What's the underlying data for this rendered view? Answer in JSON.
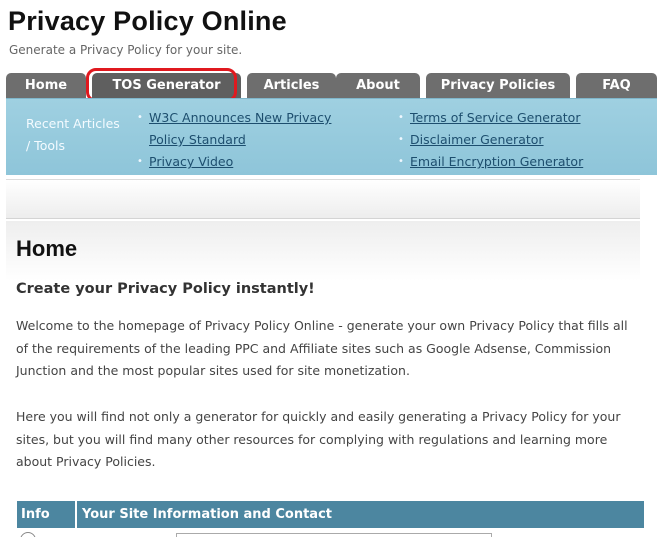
{
  "site": {
    "title": "Privacy Policy Online",
    "tagline": "Generate a Privacy Policy for your site."
  },
  "nav": {
    "tabs": [
      {
        "label": "Home"
      },
      {
        "label": "TOS Generator",
        "highlighted": true
      },
      {
        "label": "Articles"
      },
      {
        "label": "About"
      },
      {
        "label": "Privacy Policies"
      },
      {
        "label": "FAQ"
      }
    ],
    "highlight_color": "#e0191f",
    "tab_color": "#6e6e6e"
  },
  "subnav": {
    "label": "Recent Articles / Tools",
    "left_links": [
      "W3C Announces New Privacy Policy Standard",
      "Privacy Video"
    ],
    "right_links": [
      "Terms of Service Generator",
      "Disclaimer Generator",
      "Email Encryption Generator"
    ],
    "background_color": "#9fd0e1"
  },
  "main": {
    "title": "Home",
    "subtitle": "Create your Privacy Policy instantly!",
    "paragraphs": [
      "Welcome to the homepage of Privacy Policy Online - generate your own Privacy Policy that fills all of the requirements of the leading PPC and Affiliate sites such as Google Adsense, Commission Junction and the most popular sites used for site monetization.",
      "Here you will find not only a generator for quickly and easily generating a Privacy Policy for your sites, but you will find many other resources for complying with regulations and learning more about Privacy Policies."
    ]
  },
  "form_table": {
    "header": {
      "col1": "Info",
      "col2": "Your Site Information and Contact"
    },
    "header_color": "#4c86a0"
  }
}
